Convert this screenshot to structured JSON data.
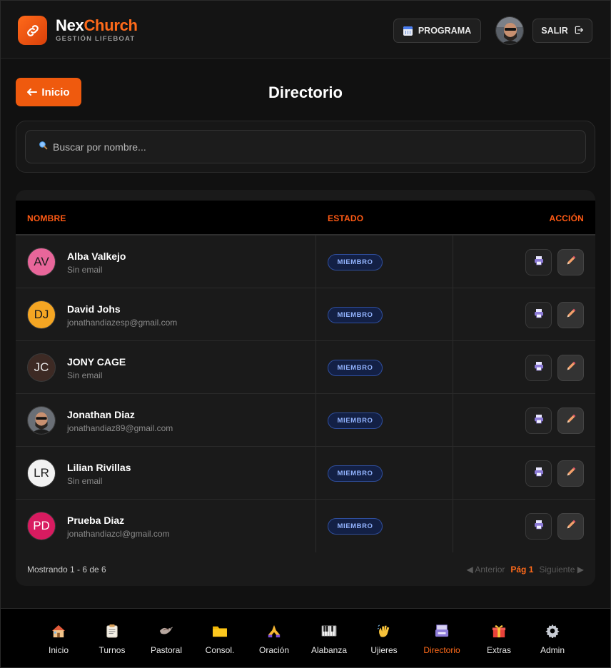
{
  "header": {
    "brand_part1": "Nex",
    "brand_part2": "Church",
    "brand_sub": "GESTIÓN LIFEBOAT",
    "programa_label": "PROGRAMA",
    "salir_label": "SALIR"
  },
  "title_row": {
    "back_label": "Inicio",
    "page_title": "Directorio"
  },
  "search": {
    "placeholder": "Buscar por nombre..."
  },
  "table": {
    "headers": {
      "name": "NOMBRE",
      "status": "ESTADO",
      "action": "ACCIÓN"
    },
    "rows": [
      {
        "initials": "AV",
        "name": "Alba Valkejo",
        "email": "Sin email",
        "status": "MIEMBRO",
        "avatar_color": "#e8669a"
      },
      {
        "initials": "DJ",
        "name": "David Johs",
        "email": "jonathandiazesp@gmail.com",
        "status": "MIEMBRO",
        "avatar_color": "#f5a623"
      },
      {
        "initials": "JC",
        "name": "JONY CAGE",
        "email": "Sin email",
        "status": "MIEMBRO",
        "avatar_color": "#3d2a24"
      },
      {
        "initials": "",
        "name": "Jonathan Diaz",
        "email": "jonathandiaz89@gmail.com",
        "status": "MIEMBRO",
        "avatar_color": "photo"
      },
      {
        "initials": "LR",
        "name": "Lilian Rivillas",
        "email": "Sin email",
        "status": "MIEMBRO",
        "avatar_color": "#f2f2f2"
      },
      {
        "initials": "PD",
        "name": "Prueba Diaz",
        "email": "jonathandiazcl@gmail.com",
        "status": "MIEMBRO",
        "avatar_color": "#d81b60"
      }
    ],
    "footer": "Mostrando 1 - 6 de 6",
    "pager": {
      "prev": "◀ Anterior",
      "current": "Pág 1",
      "next": "Siguiente ▶"
    }
  },
  "bottom_nav": [
    {
      "label": "Inicio",
      "icon": "house-icon"
    },
    {
      "label": "Turnos",
      "icon": "clipboard-icon"
    },
    {
      "label": "Pastoral",
      "icon": "dove-icon"
    },
    {
      "label": "Consol.",
      "icon": "folder-icon"
    },
    {
      "label": "Oración",
      "icon": "praying-hands-icon"
    },
    {
      "label": "Alabanza",
      "icon": "piano-icon"
    },
    {
      "label": "Ujieres",
      "icon": "waving-hand-icon"
    },
    {
      "label": "Directorio",
      "icon": "card-index-icon",
      "active": true
    },
    {
      "label": "Extras",
      "icon": "gift-icon"
    },
    {
      "label": "Admin",
      "icon": "gear-icon"
    }
  ],
  "colors": {
    "accent": "#ef5a0e",
    "badge_bg": "#132045",
    "badge_text": "#93b4ff"
  }
}
